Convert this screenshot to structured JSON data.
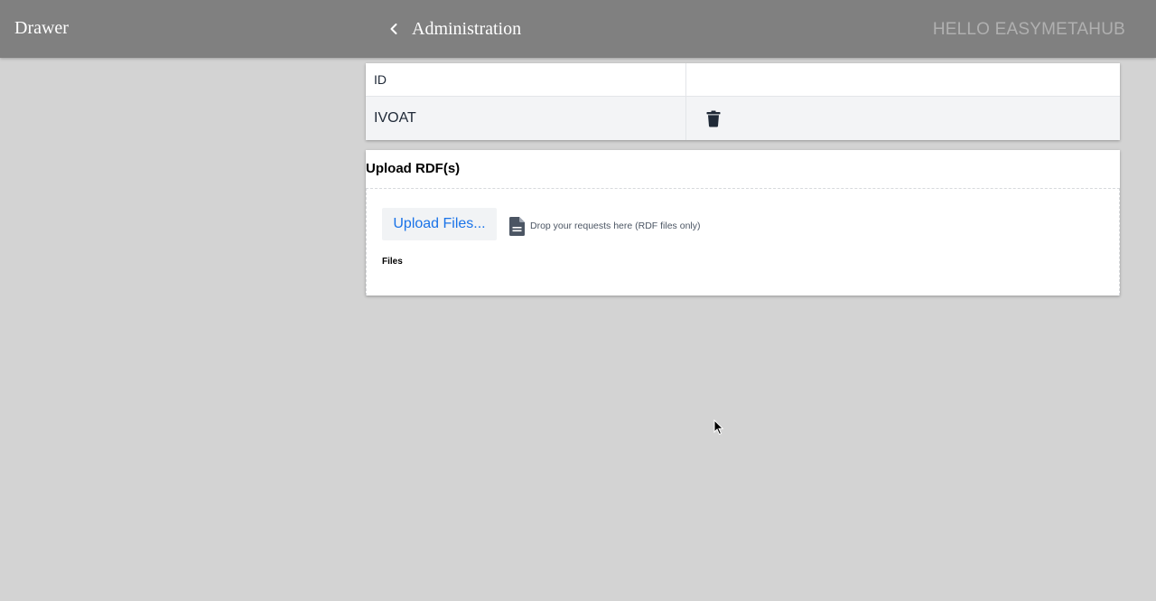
{
  "header": {
    "drawer_label": "Drawer",
    "title": "Administration",
    "greeting": "HELLO EASYMETAHUB",
    "back_icon": "chevron-left-icon"
  },
  "table": {
    "header": [
      "ID",
      ""
    ],
    "rows": [
      {
        "id": "IVOAT",
        "action_icon": "trash-icon"
      }
    ]
  },
  "upload": {
    "title": "Upload RDF(s)",
    "button_label": "Upload Files...",
    "hint_icon": "document-icon",
    "hint_text": "Drop your requests here (RDF files only)",
    "files_label": "Files"
  },
  "colors": {
    "header_bg": "#808080",
    "page_bg": "#d3d3d3",
    "link_blue": "#1a73e8",
    "row_alt_bg": "#f3f4f6"
  }
}
